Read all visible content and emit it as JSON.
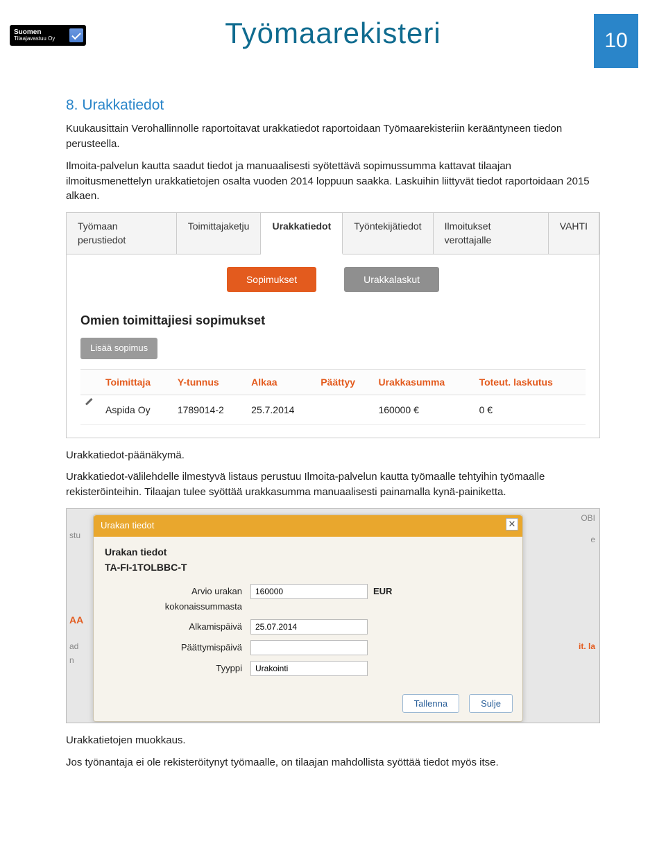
{
  "header": {
    "logo_line1": "Suomen",
    "logo_line2": "Tilaajavastuu Oy",
    "doc_title": "Työmaarekisteri",
    "page_number": "10"
  },
  "section": {
    "heading": "8. Urakkatiedot",
    "para1": "Kuukausittain Verohallinnolle raportoitavat urakkatiedot raportoidaan Työmaarekisteriin kerääntyneen tiedon perusteella.",
    "para2": "Ilmoita-palvelun kautta saadut tiedot ja manuaalisesti syötettävä sopimussumma kattavat tilaajan ilmoitusmenettelyn urakkatietojen osalta vuoden 2014 loppuun saakka. Laskuihin liittyvät tiedot raportoidaan 2015 alkaen."
  },
  "shot1": {
    "tabs": [
      "Työmaan perustiedot",
      "Toimittajaketju",
      "Urakkatiedot",
      "Työntekijätiedot",
      "Ilmoitukset verottajalle",
      "VAHTI"
    ],
    "active_tab_index": 2,
    "subtabs": {
      "primary": "Sopimukset",
      "secondary": "Urakkalaskut"
    },
    "panel_heading": "Omien toimittajiesi sopimukset",
    "add_button": "Lisää sopimus",
    "columns": [
      "Toimittaja",
      "Y-tunnus",
      "Alkaa",
      "Päättyy",
      "Urakkasumma",
      "Toteut. laskutus"
    ],
    "row": {
      "toimittaja": "Aspida Oy",
      "ytunnus": "1789014-2",
      "alkaa": "25.7.2014",
      "paattyy": "",
      "urakkasumma": "160000 €",
      "toteut": "0 €"
    }
  },
  "caption1": "Urakkatiedot-päänäkymä.",
  "mid_para": "Urakkatiedot-välilehdelle ilmestyvä listaus perustuu Ilmoita-palvelun kautta työmaalle tehtyihin työmaalle rekisteröinteihin. Tilaajan tulee syöttää urakkasumma manuaalisesti painamalla kynä-painiketta.",
  "shot2": {
    "bg_left_top": "stu",
    "bg_left_aa": "AA",
    "bg_left_ad": "ad",
    "bg_left_n": "n",
    "bg_right_obi": "OBI",
    "bg_right_e": "e",
    "bg_right_it": "it. la",
    "modal": {
      "title": "Urakan tiedot",
      "heading": "Urakan tiedot",
      "id": "TA-FI-1TOLBBC-T",
      "fields": {
        "arvio_label_1": "Arvio urakan",
        "arvio_label_2": "kokonaissummasta",
        "arvio_value": "160000",
        "arvio_unit": "EUR",
        "alku_label": "Alkamispäivä",
        "alku_value": "25.07.2014",
        "paattymis_label": "Päättymispäivä",
        "tyyppi_label": "Tyyppi",
        "tyyppi_value": "Urakointi"
      },
      "buttons": {
        "save": "Tallenna",
        "close": "Sulje"
      }
    }
  },
  "caption2": "Urakkatietojen muokkaus.",
  "final_para": "Jos työnantaja ei ole rekisteröitynyt työmaalle, on tilaajan mahdollista syöttää tiedot myös itse."
}
